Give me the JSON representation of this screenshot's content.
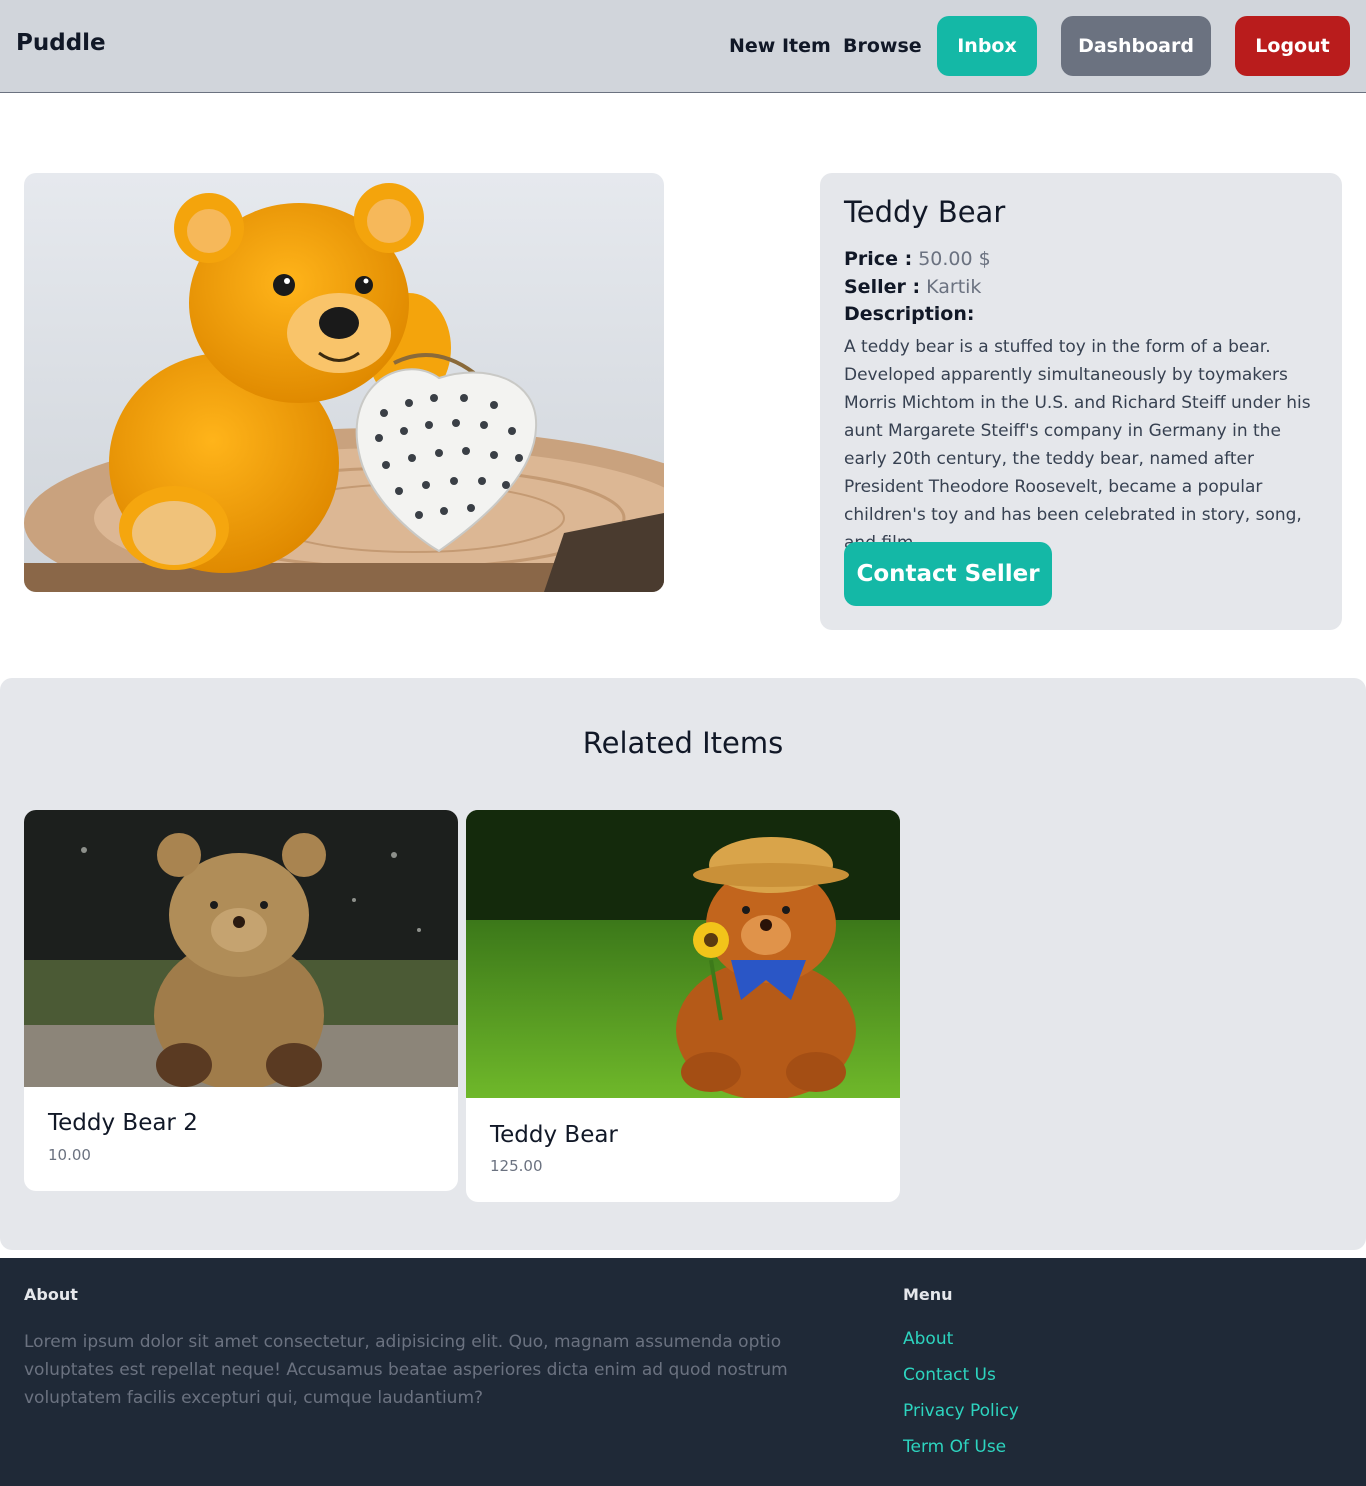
{
  "nav": {
    "brand": "Puddle",
    "links": [
      "New Item",
      "Browse"
    ],
    "buttons": [
      {
        "label": "Inbox",
        "color": "#14b8a6"
      },
      {
        "label": "Dashboard",
        "color": "#6b7280"
      },
      {
        "label": "Logout",
        "color": "#b91c1c"
      }
    ]
  },
  "item": {
    "title": "Teddy Bear",
    "price_label": "Price :",
    "price_value": "50.00 $",
    "seller_label": "Seller :",
    "seller_value": "Kartik",
    "description_label": "Description:",
    "description": "A teddy bear is a stuffed toy in the form of a bear. Developed apparently simultaneously by toymakers Morris Michtom in the U.S. and Richard Steiff under his aunt Margarete Steiff's company in Germany in the early 20th century, the teddy bear, named after President Theodore Roosevelt, became a popular children's toy and has been celebrated in story, song, and film.",
    "contact_label": "Contact Seller"
  },
  "related": {
    "title": "Related Items",
    "items": [
      {
        "name": "Teddy Bear 2",
        "price": "10.00"
      },
      {
        "name": "Teddy Bear",
        "price": "125.00"
      }
    ]
  },
  "footer": {
    "about_heading": "About",
    "about_text": "Lorem ipsum dolor sit amet consectetur, adipisicing elit. Quo, magnam assumenda optio voluptates est repellat neque! Accusamus beatae asperiores dicta enim ad quod nostrum voluptatem facilis excepturi qui, cumque laudantium?",
    "menu_heading": "Menu",
    "menu": [
      "About",
      "Contact Us",
      "Privacy Policy",
      "Term Of Use"
    ]
  },
  "colors": {
    "accent": "#14b8a6",
    "danger": "#b91c1c",
    "neutral": "#6b7280",
    "footer_bg": "#1f2937",
    "footer_link": "#2dd4bf"
  }
}
